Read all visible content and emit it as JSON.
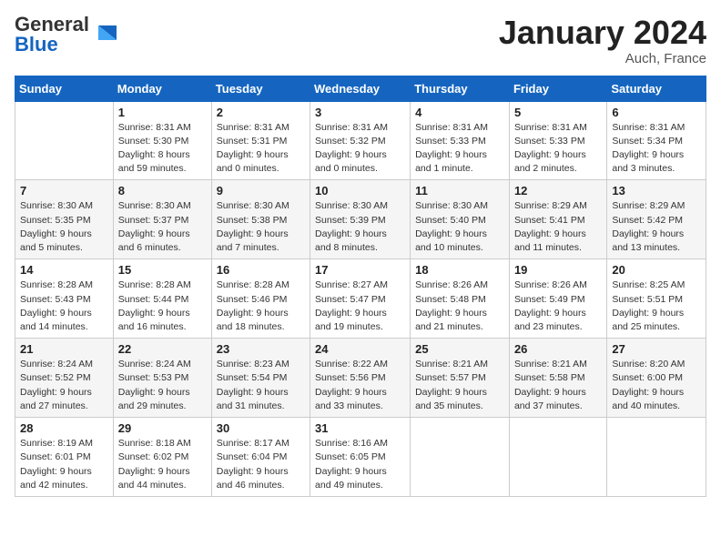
{
  "logo": {
    "general": "General",
    "blue": "Blue"
  },
  "header": {
    "month": "January 2024",
    "location": "Auch, France"
  },
  "weekdays": [
    "Sunday",
    "Monday",
    "Tuesday",
    "Wednesday",
    "Thursday",
    "Friday",
    "Saturday"
  ],
  "weeks": [
    [
      {
        "day": "",
        "info": ""
      },
      {
        "day": "1",
        "info": "Sunrise: 8:31 AM\nSunset: 5:30 PM\nDaylight: 8 hours\nand 59 minutes."
      },
      {
        "day": "2",
        "info": "Sunrise: 8:31 AM\nSunset: 5:31 PM\nDaylight: 9 hours\nand 0 minutes."
      },
      {
        "day": "3",
        "info": "Sunrise: 8:31 AM\nSunset: 5:32 PM\nDaylight: 9 hours\nand 0 minutes."
      },
      {
        "day": "4",
        "info": "Sunrise: 8:31 AM\nSunset: 5:33 PM\nDaylight: 9 hours\nand 1 minute."
      },
      {
        "day": "5",
        "info": "Sunrise: 8:31 AM\nSunset: 5:33 PM\nDaylight: 9 hours\nand 2 minutes."
      },
      {
        "day": "6",
        "info": "Sunrise: 8:31 AM\nSunset: 5:34 PM\nDaylight: 9 hours\nand 3 minutes."
      }
    ],
    [
      {
        "day": "7",
        "info": "Sunrise: 8:30 AM\nSunset: 5:35 PM\nDaylight: 9 hours\nand 5 minutes."
      },
      {
        "day": "8",
        "info": "Sunrise: 8:30 AM\nSunset: 5:37 PM\nDaylight: 9 hours\nand 6 minutes."
      },
      {
        "day": "9",
        "info": "Sunrise: 8:30 AM\nSunset: 5:38 PM\nDaylight: 9 hours\nand 7 minutes."
      },
      {
        "day": "10",
        "info": "Sunrise: 8:30 AM\nSunset: 5:39 PM\nDaylight: 9 hours\nand 8 minutes."
      },
      {
        "day": "11",
        "info": "Sunrise: 8:30 AM\nSunset: 5:40 PM\nDaylight: 9 hours\nand 10 minutes."
      },
      {
        "day": "12",
        "info": "Sunrise: 8:29 AM\nSunset: 5:41 PM\nDaylight: 9 hours\nand 11 minutes."
      },
      {
        "day": "13",
        "info": "Sunrise: 8:29 AM\nSunset: 5:42 PM\nDaylight: 9 hours\nand 13 minutes."
      }
    ],
    [
      {
        "day": "14",
        "info": "Sunrise: 8:28 AM\nSunset: 5:43 PM\nDaylight: 9 hours\nand 14 minutes."
      },
      {
        "day": "15",
        "info": "Sunrise: 8:28 AM\nSunset: 5:44 PM\nDaylight: 9 hours\nand 16 minutes."
      },
      {
        "day": "16",
        "info": "Sunrise: 8:28 AM\nSunset: 5:46 PM\nDaylight: 9 hours\nand 18 minutes."
      },
      {
        "day": "17",
        "info": "Sunrise: 8:27 AM\nSunset: 5:47 PM\nDaylight: 9 hours\nand 19 minutes."
      },
      {
        "day": "18",
        "info": "Sunrise: 8:26 AM\nSunset: 5:48 PM\nDaylight: 9 hours\nand 21 minutes."
      },
      {
        "day": "19",
        "info": "Sunrise: 8:26 AM\nSunset: 5:49 PM\nDaylight: 9 hours\nand 23 minutes."
      },
      {
        "day": "20",
        "info": "Sunrise: 8:25 AM\nSunset: 5:51 PM\nDaylight: 9 hours\nand 25 minutes."
      }
    ],
    [
      {
        "day": "21",
        "info": "Sunrise: 8:24 AM\nSunset: 5:52 PM\nDaylight: 9 hours\nand 27 minutes."
      },
      {
        "day": "22",
        "info": "Sunrise: 8:24 AM\nSunset: 5:53 PM\nDaylight: 9 hours\nand 29 minutes."
      },
      {
        "day": "23",
        "info": "Sunrise: 8:23 AM\nSunset: 5:54 PM\nDaylight: 9 hours\nand 31 minutes."
      },
      {
        "day": "24",
        "info": "Sunrise: 8:22 AM\nSunset: 5:56 PM\nDaylight: 9 hours\nand 33 minutes."
      },
      {
        "day": "25",
        "info": "Sunrise: 8:21 AM\nSunset: 5:57 PM\nDaylight: 9 hours\nand 35 minutes."
      },
      {
        "day": "26",
        "info": "Sunrise: 8:21 AM\nSunset: 5:58 PM\nDaylight: 9 hours\nand 37 minutes."
      },
      {
        "day": "27",
        "info": "Sunrise: 8:20 AM\nSunset: 6:00 PM\nDaylight: 9 hours\nand 40 minutes."
      }
    ],
    [
      {
        "day": "28",
        "info": "Sunrise: 8:19 AM\nSunset: 6:01 PM\nDaylight: 9 hours\nand 42 minutes."
      },
      {
        "day": "29",
        "info": "Sunrise: 8:18 AM\nSunset: 6:02 PM\nDaylight: 9 hours\nand 44 minutes."
      },
      {
        "day": "30",
        "info": "Sunrise: 8:17 AM\nSunset: 6:04 PM\nDaylight: 9 hours\nand 46 minutes."
      },
      {
        "day": "31",
        "info": "Sunrise: 8:16 AM\nSunset: 6:05 PM\nDaylight: 9 hours\nand 49 minutes."
      },
      {
        "day": "",
        "info": ""
      },
      {
        "day": "",
        "info": ""
      },
      {
        "day": "",
        "info": ""
      }
    ]
  ]
}
